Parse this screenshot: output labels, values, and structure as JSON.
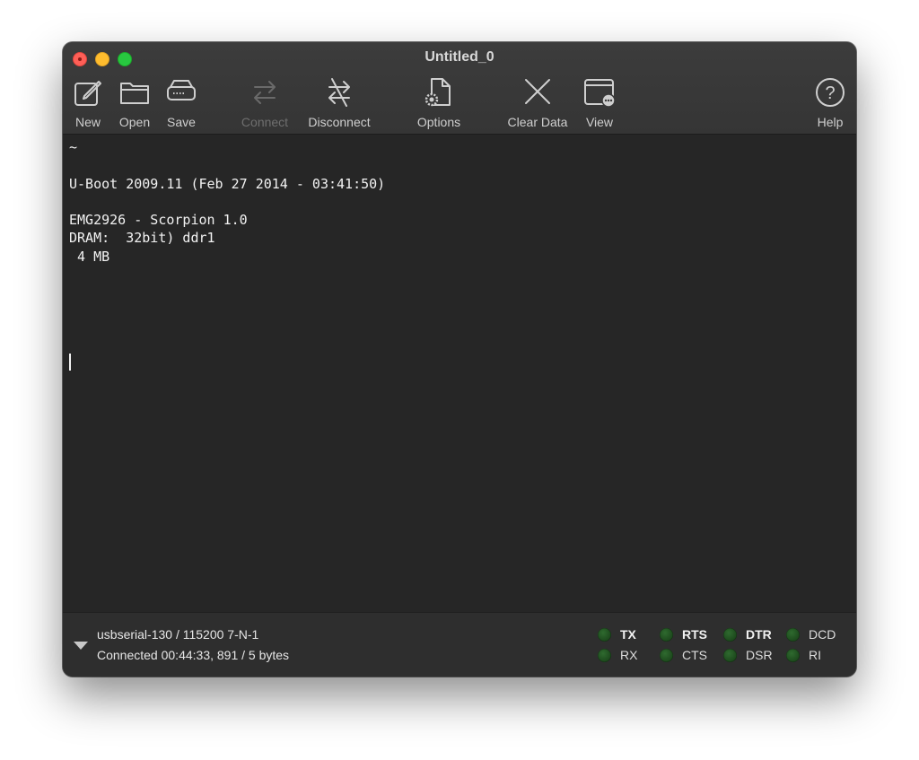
{
  "window": {
    "title": "Untitled_0"
  },
  "toolbar": {
    "new": "New",
    "open": "Open",
    "save": "Save",
    "connect": "Connect",
    "disconnect": "Disconnect",
    "options": "Options",
    "clear_data": "Clear Data",
    "view": "View",
    "help": "Help"
  },
  "terminal": {
    "text": "~\n\nU-Boot 2009.11 (Feb 27 2014 - 03:41:50)\n\nEMG2926 - Scorpion 1.0\nDRAM:  32bit) ddr1\n 4 MB"
  },
  "status": {
    "port": "usbserial-130 / 115200 7-N-1",
    "connection": "Connected 00:44:33, 891 / 5 bytes",
    "signals": [
      {
        "name": "TX",
        "bold": true
      },
      {
        "name": "RX",
        "bold": false
      },
      {
        "name": "RTS",
        "bold": true
      },
      {
        "name": "CTS",
        "bold": false
      },
      {
        "name": "DTR",
        "bold": true
      },
      {
        "name": "DSR",
        "bold": false
      },
      {
        "name": "DCD",
        "bold": false
      },
      {
        "name": "RI",
        "bold": false
      }
    ],
    "led_color": "#1f4f1f"
  }
}
